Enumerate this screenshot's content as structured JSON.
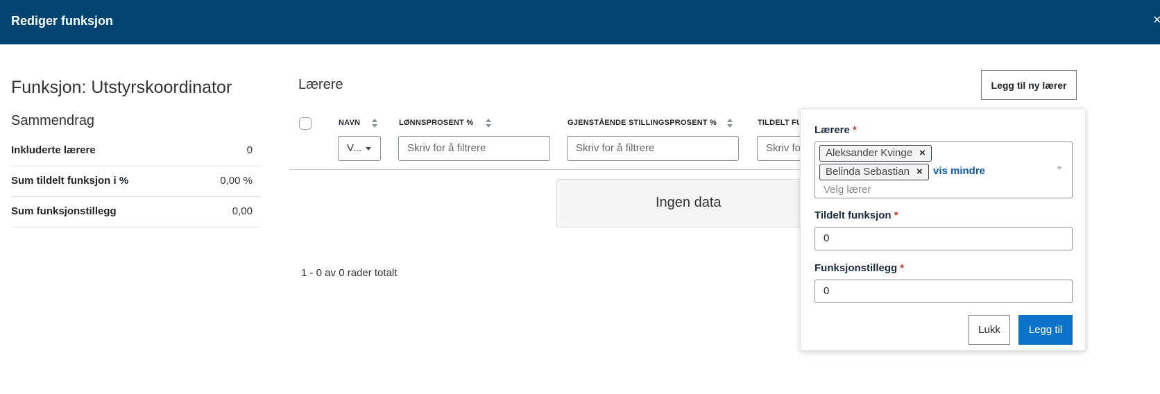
{
  "header": {
    "title": "Rediger funksjon",
    "close_glyph": "×"
  },
  "left": {
    "function_title": "Funksjon: Utstyrskoordinator",
    "summary_title": "Sammendrag",
    "summary_rows": [
      {
        "label": "Inkluderte lærere",
        "value": "0"
      },
      {
        "label": "Sum tildelt funksjon i %",
        "value": "0,00 %"
      },
      {
        "label": "Sum funksjonstillegg",
        "value": "0,00"
      }
    ]
  },
  "teachers": {
    "title": "Lærere",
    "add_button": "Legg til ny lærer",
    "columns": [
      {
        "label": "NAVN",
        "filter_value": "V..."
      },
      {
        "label": "LØNNSPROSENT %",
        "filter_placeholder": "Skriv for å filtrere"
      },
      {
        "label": "GJENSTÅENDE STILLINGSPROSENT %",
        "filter_placeholder": "Skriv for å filtrere"
      },
      {
        "label": "TILDELT FU",
        "filter_placeholder": "Skriv fo"
      }
    ],
    "no_data": "Ingen data",
    "rows_total": "1 - 0 av 0 rader totalt"
  },
  "popover": {
    "teachers_label": "Lærere",
    "required_mark": "*",
    "chips": [
      "Aleksander Kvinge",
      "Belinda Sebastian"
    ],
    "chip_remove_glyph": "×",
    "show_less": "vis mindre",
    "select_placeholder": "Velg lærer",
    "assigned_label": "Tildelt funksjon",
    "assigned_value": "0",
    "allowance_label": "Funksjonstillegg",
    "allowance_value": "0",
    "close_button": "Lukk",
    "add_button": "Legg til"
  }
}
